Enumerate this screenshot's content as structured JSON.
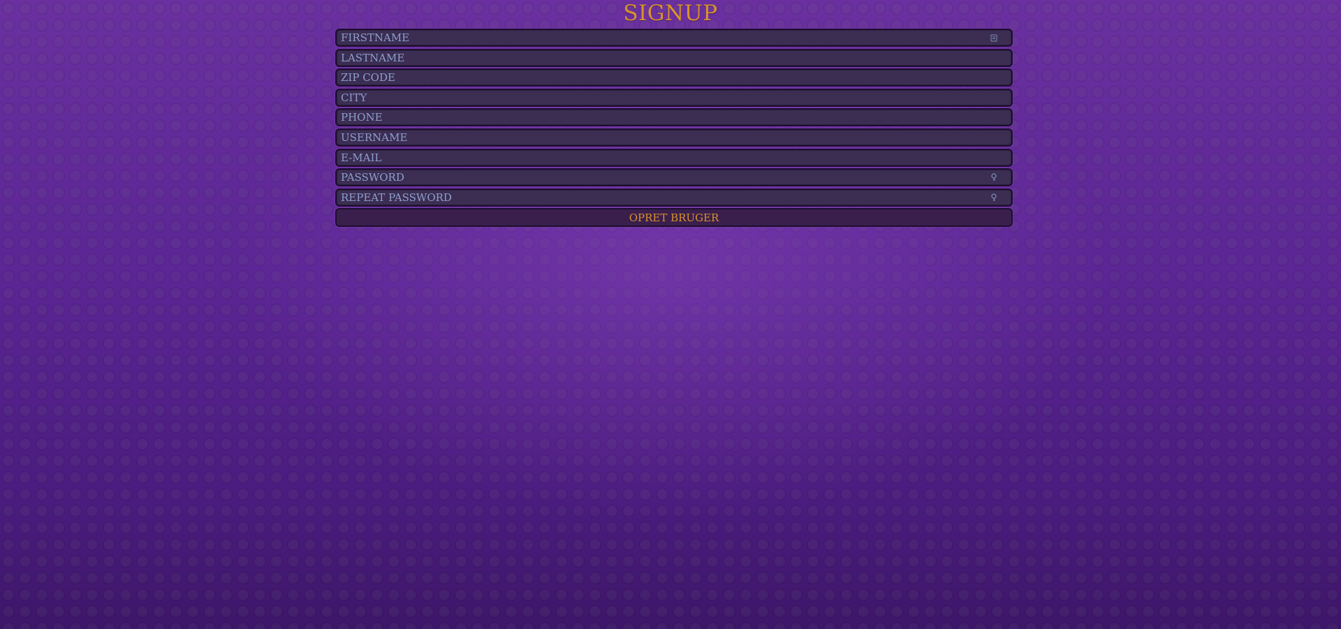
{
  "page": {
    "title": "SIGNUP"
  },
  "form": {
    "fields": [
      {
        "name": "firstname",
        "placeholder": "FIRSTNAME",
        "value": "",
        "icon": "id-card-icon"
      },
      {
        "name": "lastname",
        "placeholder": "LASTNAME",
        "value": "",
        "icon": ""
      },
      {
        "name": "zip-code",
        "placeholder": "ZIP CODE",
        "value": "",
        "icon": ""
      },
      {
        "name": "city",
        "placeholder": "CITY",
        "value": "",
        "icon": ""
      },
      {
        "name": "phone",
        "placeholder": "PHONE",
        "value": "",
        "icon": ""
      },
      {
        "name": "username",
        "placeholder": "USERNAME",
        "value": "",
        "icon": ""
      },
      {
        "name": "email",
        "placeholder": "E-MAIL",
        "value": "",
        "icon": ""
      },
      {
        "name": "password",
        "placeholder": "PASSWORD",
        "value": "",
        "icon": "key-icon"
      },
      {
        "name": "repeat-password",
        "placeholder": "REPEAT PASSWORD",
        "value": "",
        "icon": "key-icon"
      }
    ],
    "submit_label": "OPRET BRUGER"
  },
  "colors": {
    "accent": "#d9922c",
    "placeholder": "#8d9fce",
    "field_background": "#3b2e52",
    "field_border": "#1e0d31",
    "background": "#5a2690"
  }
}
